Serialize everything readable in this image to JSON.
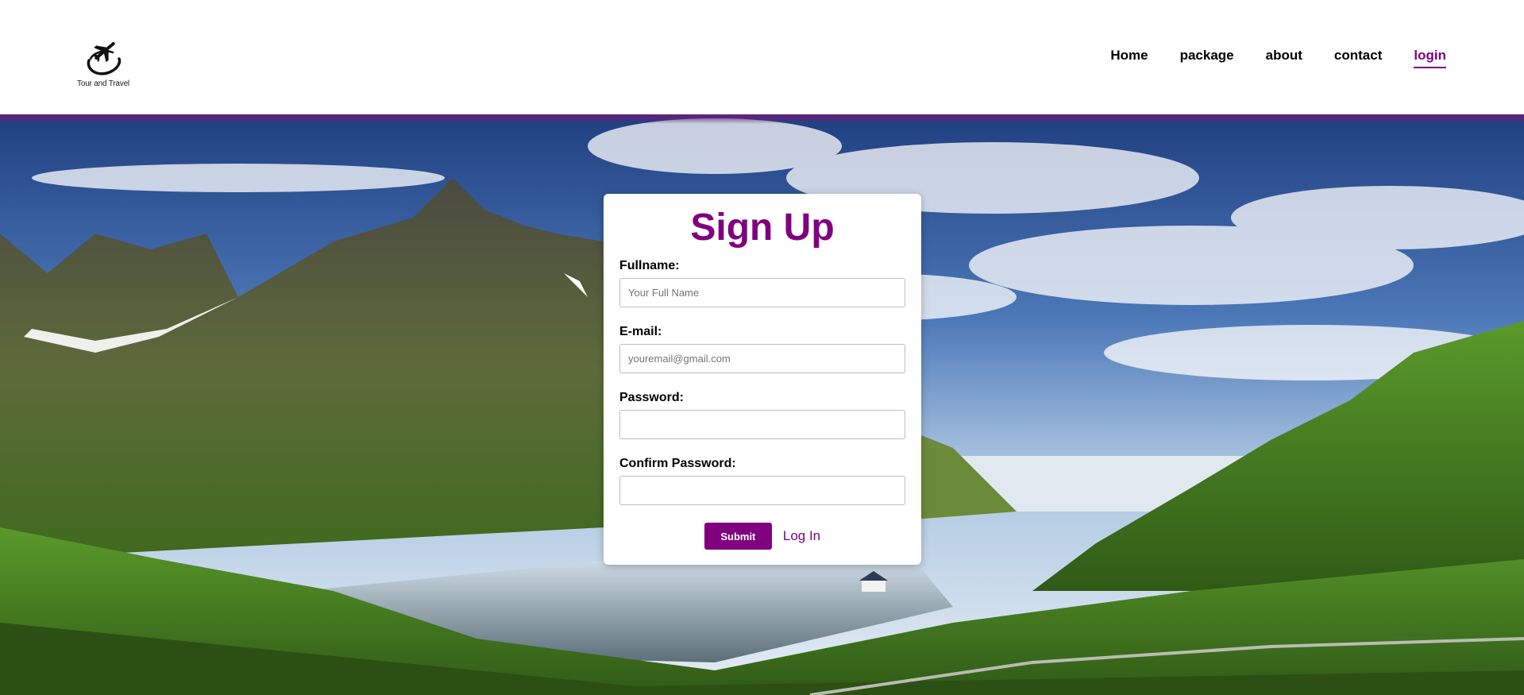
{
  "brand": {
    "logo_text": "Tour and Travel"
  },
  "nav": {
    "items": [
      {
        "label": "Home"
      },
      {
        "label": "package"
      },
      {
        "label": "about"
      },
      {
        "label": "contact"
      },
      {
        "label": "login",
        "active": true
      }
    ]
  },
  "signup": {
    "title": "Sign Up",
    "fullname": {
      "label": "Fullname:",
      "placeholder": "Your Full Name",
      "value": ""
    },
    "email": {
      "label": "E-mail:",
      "placeholder": "youremail@gmail.com",
      "value": ""
    },
    "password": {
      "label": "Password:",
      "placeholder": "",
      "value": ""
    },
    "confirm": {
      "label": "Confirm Password:",
      "placeholder": "",
      "value": ""
    },
    "submit_label": "Submit",
    "login_link": "Log In"
  },
  "colors": {
    "accent": "#800080",
    "text": "#000000",
    "card_bg": "#ffffff"
  },
  "icons": {
    "logo": "airplane-logo-icon"
  }
}
